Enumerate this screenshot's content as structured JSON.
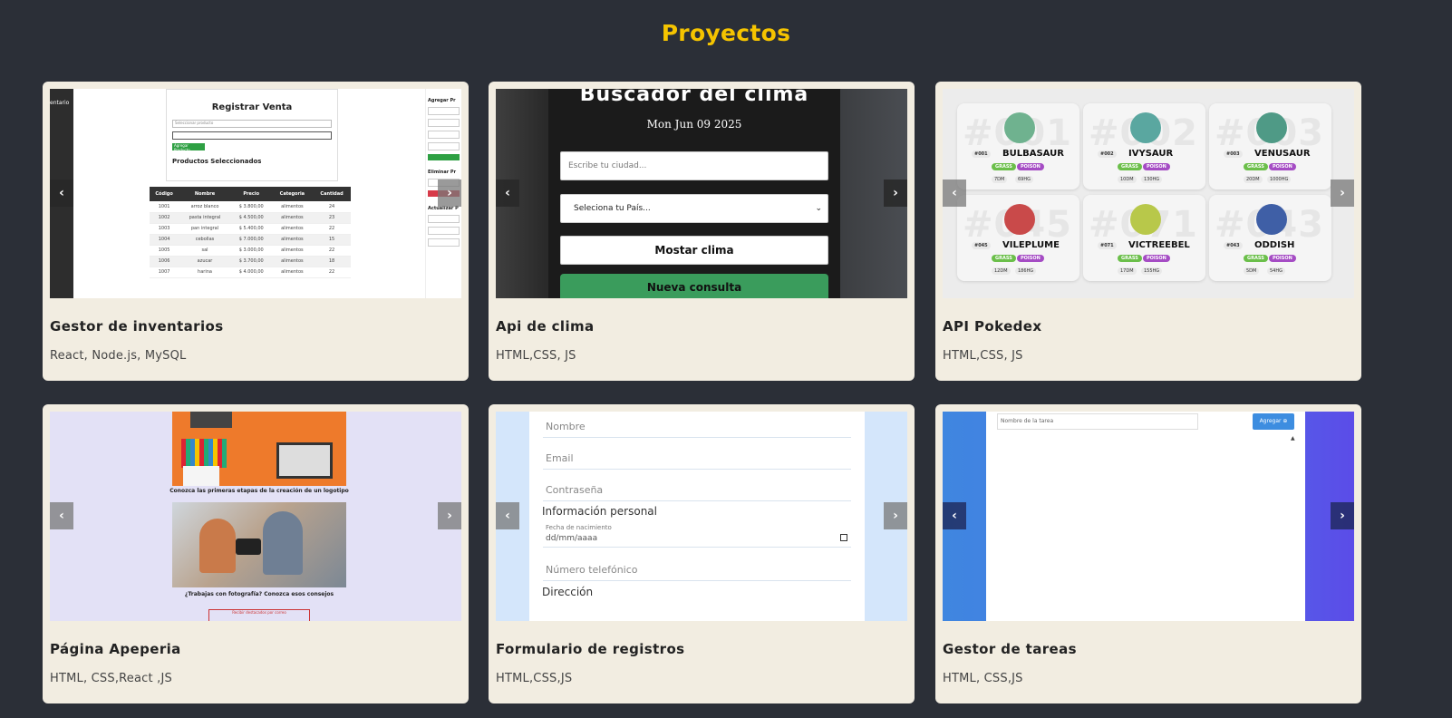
{
  "page": {
    "title": "Proyectos"
  },
  "nav": {
    "prev": "‹",
    "next": "›"
  },
  "cards": [
    {
      "title": "Gestor de inventarios",
      "tech": "React, Node.js, MySQL",
      "screenshot": {
        "side_label": "entario",
        "panel_title": "Registrar Venta",
        "select_placeholder": "Seleccionar producto",
        "button": "Agregar Producto",
        "subtitle": "Productos Seleccionados",
        "table_headers": [
          "Código",
          "Nombre",
          "Precio",
          "Categoria",
          "Cantidad"
        ],
        "table_rows": [
          [
            "1001",
            "arroz blanco",
            "$ 3.800,00",
            "alimentos",
            "24"
          ],
          [
            "1002",
            "pasta integral",
            "$ 4.500,00",
            "alimentos",
            "23"
          ],
          [
            "1003",
            "pan integral",
            "$ 5.400,00",
            "alimentos",
            "22"
          ],
          [
            "1004",
            "cebollas",
            "$ 7.000,00",
            "alimentos",
            "15"
          ],
          [
            "1005",
            "sal",
            "$ 3.000,00",
            "alimentos",
            "22"
          ],
          [
            "1006",
            "azucar",
            "$ 3.700,00",
            "alimentos",
            "18"
          ],
          [
            "1007",
            "harina",
            "$ 4.000,00",
            "alimentos",
            "22"
          ]
        ],
        "right_title": "Agregar Pr",
        "right_section": "Eliminar Pr",
        "right_section2": "Actualizar P"
      }
    },
    {
      "title": "Api de clima",
      "tech": "HTML,CSS, JS",
      "screenshot": {
        "heading": "Buscador del clima",
        "date": "Mon Jun 09 2025",
        "city_placeholder": "Escribe tu ciudad...",
        "country_select": "Seleciona tu País...",
        "show_button": "Mostar clima",
        "new_button": "Nueva consulta"
      }
    },
    {
      "title": "API Pokedex",
      "tech": "HTML,CSS, JS",
      "screenshot": {
        "pokemon": [
          {
            "number": "#001",
            "big": "#001",
            "name": "BULBASAUR",
            "types": [
              "GRASS",
              "POISON"
            ],
            "height": "7DM",
            "weight": "69HG",
            "color": "#6fb28f"
          },
          {
            "number": "#002",
            "big": "#002",
            "name": "IVYSAUR",
            "types": [
              "GRASS",
              "POISON"
            ],
            "height": "10DM",
            "weight": "130HG",
            "color": "#5aa7a0"
          },
          {
            "number": "#003",
            "big": "#003",
            "name": "VENUSAUR",
            "types": [
              "GRASS",
              "POISON"
            ],
            "height": "20DM",
            "weight": "1000HG",
            "color": "#4f9a86"
          },
          {
            "number": "#045",
            "big": "#045",
            "name": "VILEPLUME",
            "types": [
              "GRASS",
              "POISON"
            ],
            "height": "12DM",
            "weight": "186HG",
            "color": "#c94a4a"
          },
          {
            "number": "#071",
            "big": "#071",
            "name": "VICTREEBEL",
            "types": [
              "GRASS",
              "POISON"
            ],
            "height": "17DM",
            "weight": "155HG",
            "color": "#b8c84a"
          },
          {
            "number": "#043",
            "big": "#043",
            "name": "ODDISH",
            "types": [
              "GRASS",
              "POISON"
            ],
            "height": "5DM",
            "weight": "54HG",
            "color": "#3f5fa6"
          }
        ]
      }
    },
    {
      "title": "Página Apeperia",
      "tech": "HTML, CSS,React ,JS",
      "screenshot": {
        "caption1": "Conozca las primeras etapas de la creación de un logotipo",
        "caption2": "¿Trabajas con fotografía? Conozca esos consejos",
        "link": "Recibir destacados por correo"
      }
    },
    {
      "title": "Formulario de registros",
      "tech": "HTML,CSS,JS",
      "screenshot": {
        "name_placeholder": "Nombre",
        "email_placeholder": "Email",
        "password_placeholder": "Contraseña",
        "section_personal": "Información personal",
        "birth_label": "Fecha de nacimiento",
        "birth_value": "dd/mm/aaaa",
        "phone_placeholder": "Número telefónico",
        "section_address": "Dirección"
      }
    },
    {
      "title": "Gestor de tareas",
      "tech": "HTML, CSS,JS",
      "screenshot": {
        "task_placeholder": "Nombre de la tarea",
        "add_button": "Agregar ⊕",
        "scroll_glyph": "▲"
      }
    }
  ]
}
